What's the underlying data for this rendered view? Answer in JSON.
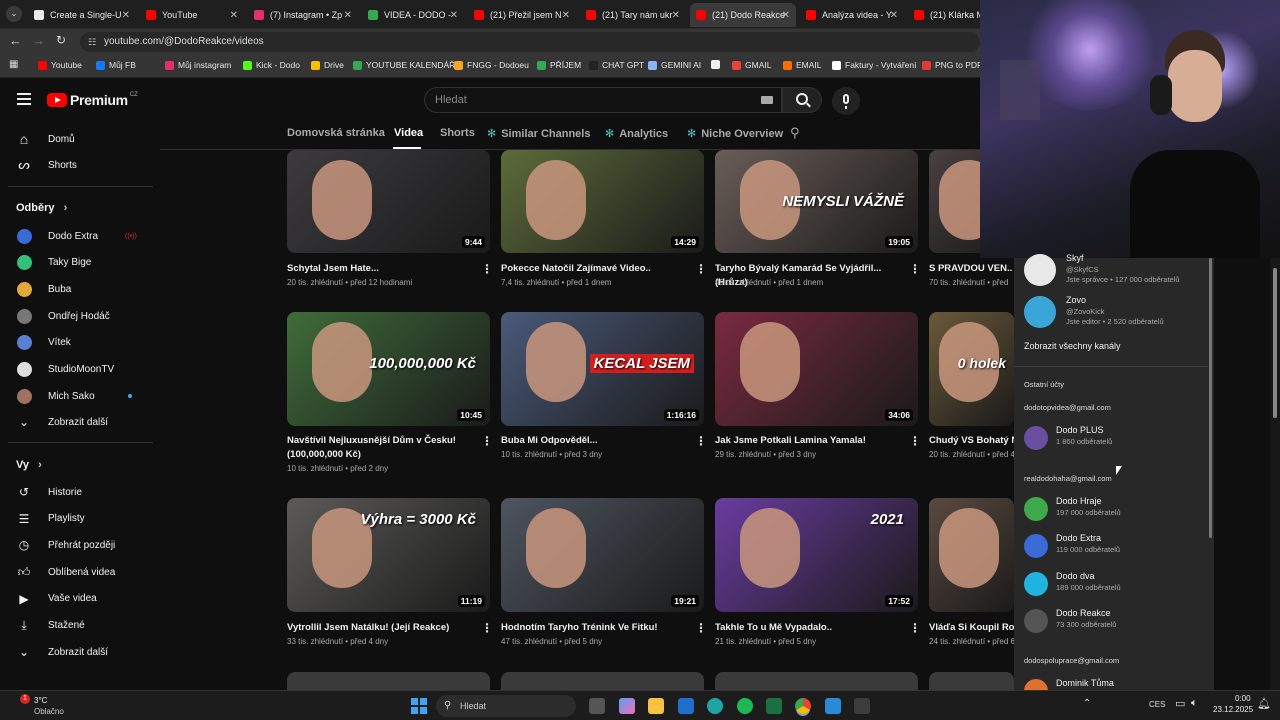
{
  "browser": {
    "tabs": [
      {
        "label": "Create a Single-U",
        "color": "#e8e8e8"
      },
      {
        "label": "YouTube",
        "color": "#ff0000"
      },
      {
        "label": "(7) Instagram • Zp",
        "color": "#e1306c"
      },
      {
        "label": "VIDEA - DODO -",
        "color": "#34a853"
      },
      {
        "label": "(21) Přežil jsem N",
        "color": "#ff0000"
      },
      {
        "label": "(21) Tary nám ukr",
        "color": "#ff0000"
      },
      {
        "label": "(21) Dodo Reakce",
        "color": "#ff0000"
      },
      {
        "label": "Analýza videa - Y",
        "color": "#ff0000"
      },
      {
        "label": "(21) Klárka M",
        "color": "#ff0000"
      }
    ],
    "url": "youtube.com/@DodoReakce/videos",
    "bookmarks": [
      {
        "label": "Youtube",
        "color": "#ff0000"
      },
      {
        "label": "Můj FB",
        "color": "#1877f2"
      },
      {
        "label": "Můj instagram",
        "color": "#e1306c"
      },
      {
        "label": "Kick - Dodo",
        "color": "#53fc18"
      },
      {
        "label": "Drive",
        "color": "#fbbc04"
      },
      {
        "label": "YOUTUBE KALENDÁŘ",
        "color": "#34a853"
      },
      {
        "label": "FNGG - Dodoeu",
        "color": "#f5a623"
      },
      {
        "label": "PŘÍJEM",
        "color": "#34a853"
      },
      {
        "label": "CHAT GPT",
        "color": "#222222"
      },
      {
        "label": "GEMINI AI",
        "color": "#8ab4f8"
      },
      {
        "label": "",
        "color": "#eeeeee"
      },
      {
        "label": "GMAIL",
        "color": "#ea4335"
      },
      {
        "label": "EMAIL",
        "color": "#ff6d00"
      },
      {
        "label": "Faktury - Vytváření",
        "color": "#ffffff"
      },
      {
        "label": "PNG to PDF",
        "color": "#e53935"
      }
    ]
  },
  "header": {
    "logo": "Premium",
    "logo_badge": "CZ",
    "search_placeholder": "Hledat"
  },
  "sidebar": {
    "main": [
      {
        "label": "Domů",
        "icon": "home-icon"
      },
      {
        "label": "Shorts",
        "icon": "shorts-icon"
      }
    ],
    "subs_heading": "Odběry",
    "subs": [
      {
        "label": "Dodo Extra",
        "color": "#3a6ad6"
      },
      {
        "label": "Taky Bige",
        "color": "#32c07a"
      },
      {
        "label": "Buba",
        "color": "#e1a93a"
      },
      {
        "label": "Ondřej Hodáč",
        "color": "#777777"
      },
      {
        "label": "Vítek",
        "color": "#5b7fd1"
      },
      {
        "label": "StudioMoonTV",
        "color": "#dddddd"
      },
      {
        "label": "Mich Sako",
        "color": "#a07060"
      }
    ],
    "subs_more": "Zobrazit další",
    "you_heading": "Vy",
    "you": [
      {
        "label": "Historie",
        "icon": "history-icon"
      },
      {
        "label": "Playlisty",
        "icon": "playlist-icon"
      },
      {
        "label": "Přehrát později",
        "icon": "clock-icon"
      },
      {
        "label": "Oblíbená videa",
        "icon": "thumbs-up-icon"
      },
      {
        "label": "Vaše videa",
        "icon": "video-icon"
      },
      {
        "label": "Stažené",
        "icon": "download-icon"
      }
    ],
    "you_more": "Zobrazit další"
  },
  "channel_tabs": [
    "Domovská stránka",
    "Videa",
    "Shorts",
    "Similar Channels",
    "Analytics",
    "Niche Overview"
  ],
  "videos": [
    {
      "title": "Schytal Jsem Hate...",
      "views": "20 tis. zhlédnutí",
      "age": "před 12 hodinami",
      "duration": "9:44",
      "bg": "#3c3a3e"
    },
    {
      "title": "Pokecce Natočil Zajímavé Video..",
      "views": "7,4 tis. zhlédnutí",
      "age": "před 1 dnem",
      "duration": "14:29",
      "bg": "#5d6b3a"
    },
    {
      "title": "Taryho Bývalý Kamarád Se Vyjádřil... (Hrůza)",
      "views": "49 tis. zhlédnutí",
      "age": "před 1 dnem",
      "duration": "19:05",
      "bg": "#6a5d58",
      "overlay": "NEMYSLI VÁŽNĚ"
    },
    {
      "title": "S PRAVDOU VEN..",
      "views": "70 tis. zhlédnutí",
      "age": "před",
      "duration": "",
      "bg": "#4a4040"
    },
    {
      "title": "Navštívil Nejluxusnější Dům v Česku! (100,000,000 Kč)",
      "views": "10 tis. zhlédnutí",
      "age": "před 2 dny",
      "duration": "10:45",
      "bg": "#3f6d3a",
      "overlay": "100,000,000 Kč"
    },
    {
      "title": "Buba Mi Odpověděl...",
      "views": "10 tis. zhlédnutí",
      "age": "před 3 dny",
      "duration": "1:16:16",
      "bg": "#4a5a7a",
      "overlay": "KECAL JSEM"
    },
    {
      "title": "Jak Jsme Potkali Lamina Yamala!",
      "views": "29 tis. zhlédnutí",
      "age": "před 3 dny",
      "duration": "34:06",
      "bg": "#7a2a40"
    },
    {
      "title": "Chudý VS Bohatý Na",
      "views": "20 tis. zhlédnutí",
      "age": "před 4",
      "duration": "",
      "bg": "#6b5a3a",
      "overlay": "0 holek"
    },
    {
      "title": "Vytrollil Jsem Natálku! (Její Reakce)",
      "views": "33 tis. zhlédnutí",
      "age": "před 4 dny",
      "duration": "11:19",
      "bg": "#5b5a58",
      "overlay": "Výhra = 3000 Kč"
    },
    {
      "title": "Hodnotím Taryho Trénink Ve Fitku!",
      "views": "47 tis. zhlédnutí",
      "age": "před 5 dny",
      "duration": "19:21",
      "bg": "#4e5560"
    },
    {
      "title": "Takhle To u Mě Vypadalo..",
      "views": "21 tis. zhlédnutí",
      "age": "před 5 dny",
      "duration": "17:52",
      "bg": "#6a3ca0",
      "overlay": "2021"
    },
    {
      "title": "Vláďa Si Koupil Role",
      "views": "24 tis. zhlédnutí",
      "age": "před 6",
      "duration": "",
      "bg": "#5a4a40"
    }
  ],
  "account_menu": {
    "top": [
      {
        "name": "Skyf",
        "handle": "@SkyfCS",
        "meta": "Jste správce • 127 000 odběratelů",
        "color": "#e8e8e8"
      },
      {
        "name": "Zovo",
        "handle": "@ZovoKick",
        "meta": "Jste editor • 2 520 odběratelů",
        "color": "#3aa6d8"
      }
    ],
    "show_all": "Zobrazit všechny kanály",
    "other_heading": "Ostatní účty",
    "email1": "dodotopvidea@gmail.com",
    "group1": [
      {
        "name": "Dodo PLUS",
        "meta": "1 860 odběratelů",
        "color": "#6a4ea0"
      }
    ],
    "email2": "realdodohaha@gmail.com",
    "group2": [
      {
        "name": "Dodo Hraje",
        "meta": "197 000 odběratelů",
        "color": "#3ea84a"
      },
      {
        "name": "Dodo Extra",
        "meta": "119 000 odběratelů",
        "color": "#3a6ad6"
      },
      {
        "name": "Dodo dva",
        "meta": "189 000 odběratelů",
        "color": "#1fb5e0"
      },
      {
        "name": "Dodo Reakce",
        "meta": "73 300 odběratelů",
        "color": "#555555"
      }
    ],
    "email3": "dodospoluprace@gmail.com",
    "group3": [
      {
        "name": "Dominik Tůma",
        "meta": "",
        "color": "#e07030"
      }
    ]
  },
  "taskbar": {
    "weather_temp": "3°C",
    "weather_text": "Oblačno",
    "search": "Hledat",
    "lang": "CES",
    "time": "0:00",
    "date": "23.12.2025",
    "notification_count": "1"
  }
}
